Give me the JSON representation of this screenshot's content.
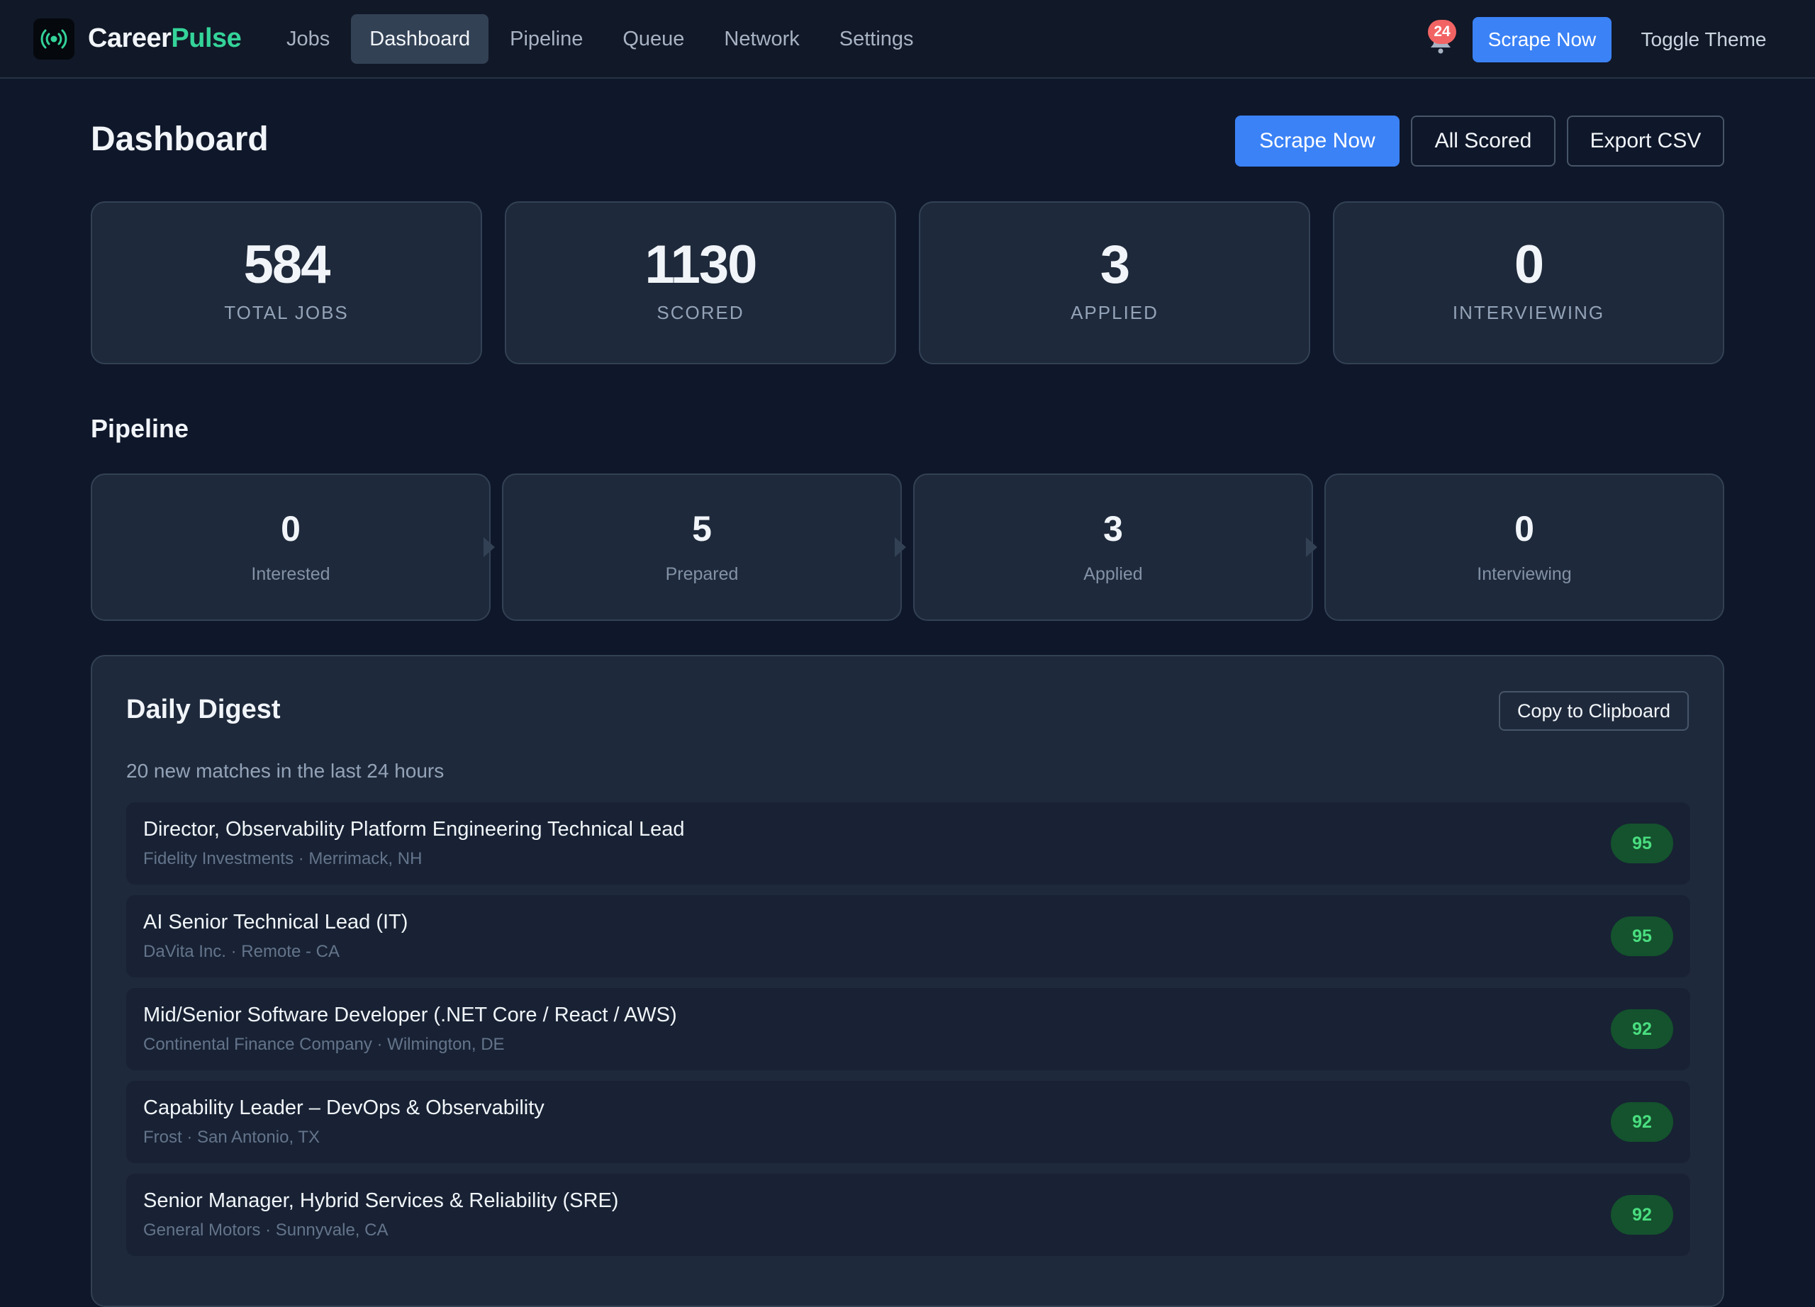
{
  "app": {
    "brand_main": "Career",
    "brand_accent": "Pulse",
    "logo_icon": "radio-signal-icon"
  },
  "nav": {
    "items": [
      "Jobs",
      "Dashboard",
      "Pipeline",
      "Queue",
      "Network",
      "Settings"
    ],
    "active": "Dashboard",
    "notification_count": "24",
    "scrape_label": "Scrape Now",
    "toggle_theme_label": "Toggle Theme"
  },
  "header": {
    "title": "Dashboard",
    "scrape_label": "Scrape Now",
    "all_scored_label": "All Scored",
    "export_label": "Export CSV"
  },
  "stats": [
    {
      "value": "584",
      "label": "Total Jobs"
    },
    {
      "value": "1130",
      "label": "Scored"
    },
    {
      "value": "3",
      "label": "Applied"
    },
    {
      "value": "0",
      "label": "Interviewing"
    }
  ],
  "pipeline": {
    "title": "Pipeline",
    "stages": [
      {
        "value": "0",
        "label": "Interested"
      },
      {
        "value": "5",
        "label": "Prepared"
      },
      {
        "value": "3",
        "label": "Applied"
      },
      {
        "value": "0",
        "label": "Interviewing"
      }
    ]
  },
  "digest": {
    "title": "Daily Digest",
    "copy_label": "Copy to Clipboard",
    "subtitle": "20 new matches in the last 24 hours",
    "jobs": [
      {
        "title": "Director, Observability Platform Engineering Technical Lead",
        "meta": "Fidelity Investments · Merrimack, NH",
        "score": "95"
      },
      {
        "title": "AI Senior Technical Lead (IT)",
        "meta": "DaVita Inc. · Remote - CA",
        "score": "95"
      },
      {
        "title": "Mid/Senior Software Developer (.NET Core / React / AWS)",
        "meta": "Continental Finance Company · Wilmington, DE",
        "score": "92"
      },
      {
        "title": "Capability Leader – DevOps & Observability",
        "meta": "Frost · San Antonio, TX",
        "score": "92"
      },
      {
        "title": "Senior Manager, Hybrid Services & Reliability (SRE)",
        "meta": "General Motors · Sunnyvale, CA",
        "score": "92"
      }
    ]
  },
  "colors": {
    "background": "#0f172a",
    "card": "#1e293b",
    "primary": "#3b82f6",
    "brand_accent": "#34d399",
    "score_bg": "#14532d",
    "score_text": "#4ade80",
    "badge": "#f26464"
  }
}
